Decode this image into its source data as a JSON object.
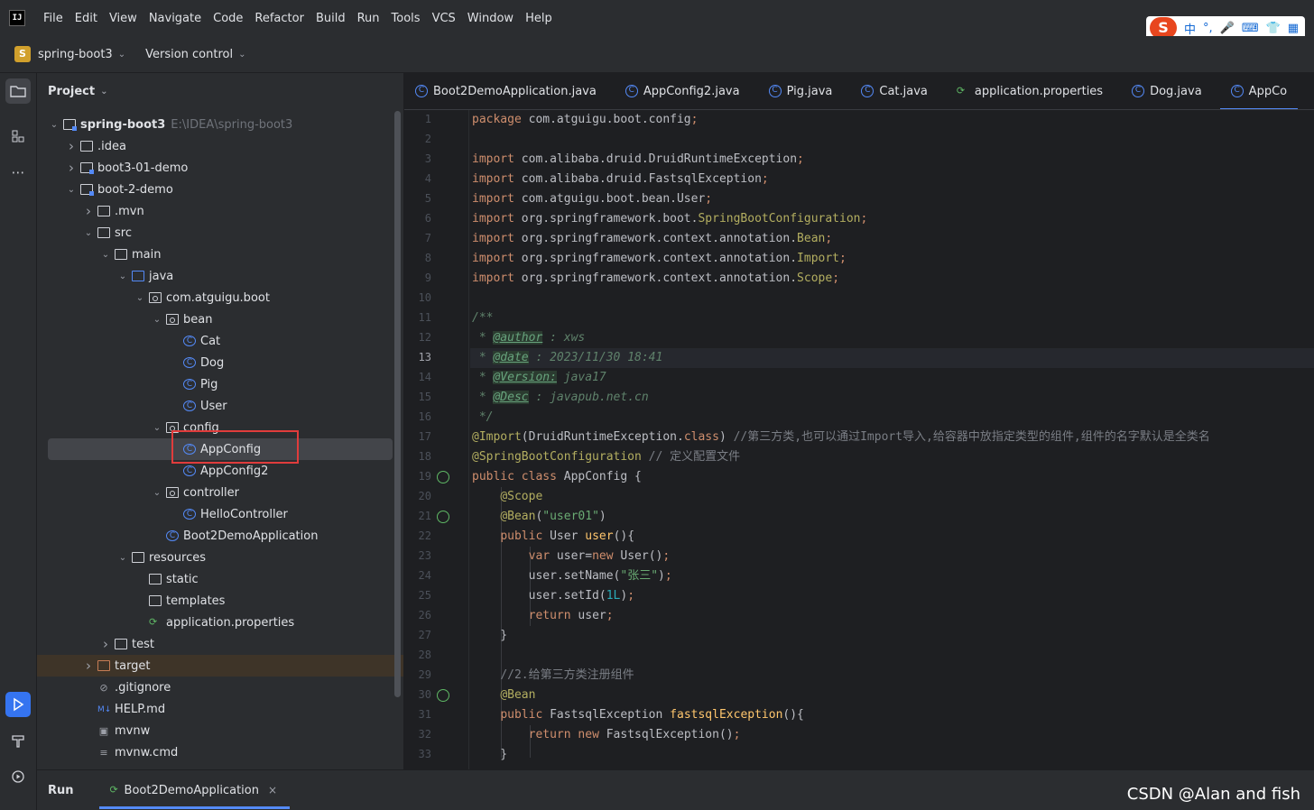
{
  "menubar": {
    "logo": "IJ",
    "items": [
      "File",
      "Edit",
      "View",
      "Navigate",
      "Code",
      "Refactor",
      "Build",
      "Run",
      "Tools",
      "VCS",
      "Window",
      "Help"
    ],
    "ime": [
      "中",
      "°,",
      "🎤",
      "⌨",
      "👕",
      "▦"
    ]
  },
  "toolbar": {
    "project_badge": "S",
    "project_name": "spring-boot3",
    "vcs_label": "Version control"
  },
  "project_panel": {
    "title": "Project",
    "tree": [
      {
        "label": "spring-boot3",
        "extra": "E:\\IDEA\\spring-boot3",
        "depth": 0,
        "arrow": "open",
        "icon": "module",
        "bold": true
      },
      {
        "label": ".idea",
        "depth": 1,
        "arrow": "closed",
        "icon": "folder"
      },
      {
        "label": "boot3-01-demo",
        "depth": 1,
        "arrow": "closed",
        "icon": "module"
      },
      {
        "label": "boot-2-demo",
        "depth": 1,
        "arrow": "open",
        "icon": "module"
      },
      {
        "label": ".mvn",
        "depth": 2,
        "arrow": "closed",
        "icon": "folder"
      },
      {
        "label": "src",
        "depth": 2,
        "arrow": "open",
        "icon": "folder"
      },
      {
        "label": "main",
        "depth": 3,
        "arrow": "open",
        "icon": "folder"
      },
      {
        "label": "java",
        "depth": 4,
        "arrow": "open",
        "icon": "folder-blue"
      },
      {
        "label": "com.atguigu.boot",
        "depth": 5,
        "arrow": "open",
        "icon": "package"
      },
      {
        "label": "bean",
        "depth": 6,
        "arrow": "open",
        "icon": "package"
      },
      {
        "label": "Cat",
        "depth": 7,
        "arrow": "none",
        "icon": "class"
      },
      {
        "label": "Dog",
        "depth": 7,
        "arrow": "none",
        "icon": "class"
      },
      {
        "label": "Pig",
        "depth": 7,
        "arrow": "none",
        "icon": "class"
      },
      {
        "label": "User",
        "depth": 7,
        "arrow": "none",
        "icon": "class"
      },
      {
        "label": "config",
        "depth": 6,
        "arrow": "open",
        "icon": "package"
      },
      {
        "label": "AppConfig",
        "depth": 7,
        "arrow": "none",
        "icon": "class",
        "selected": true
      },
      {
        "label": "AppConfig2",
        "depth": 7,
        "arrow": "none",
        "icon": "class"
      },
      {
        "label": "controller",
        "depth": 6,
        "arrow": "open",
        "icon": "package"
      },
      {
        "label": "HelloController",
        "depth": 7,
        "arrow": "none",
        "icon": "class"
      },
      {
        "label": "Boot2DemoApplication",
        "depth": 6,
        "arrow": "none",
        "icon": "class"
      },
      {
        "label": "resources",
        "depth": 4,
        "arrow": "open",
        "icon": "folder"
      },
      {
        "label": "static",
        "depth": 5,
        "arrow": "none",
        "icon": "folder"
      },
      {
        "label": "templates",
        "depth": 5,
        "arrow": "none",
        "icon": "folder"
      },
      {
        "label": "application.properties",
        "depth": 5,
        "arrow": "none",
        "icon": "props"
      },
      {
        "label": "test",
        "depth": 3,
        "arrow": "closed",
        "icon": "folder"
      },
      {
        "label": "target",
        "depth": 2,
        "arrow": "closed",
        "icon": "folder-orange"
      },
      {
        "label": ".gitignore",
        "depth": 2,
        "arrow": "none",
        "icon": "gitignore"
      },
      {
        "label": "HELP.md",
        "depth": 2,
        "arrow": "none",
        "icon": "md"
      },
      {
        "label": "mvnw",
        "depth": 2,
        "arrow": "none",
        "icon": "shell"
      },
      {
        "label": "mvnw.cmd",
        "depth": 2,
        "arrow": "none",
        "icon": "text"
      }
    ]
  },
  "tabs": [
    {
      "label": "Boot2DemoApplication.java",
      "icon": "class"
    },
    {
      "label": "AppConfig2.java",
      "icon": "class"
    },
    {
      "label": "Pig.java",
      "icon": "class"
    },
    {
      "label": "Cat.java",
      "icon": "class"
    },
    {
      "label": "application.properties",
      "icon": "props"
    },
    {
      "label": "Dog.java",
      "icon": "class"
    },
    {
      "label": "AppCo",
      "icon": "class",
      "active": true
    }
  ],
  "editor": {
    "current_line": 13,
    "line_numbers": [
      "1",
      "2",
      "3",
      "4",
      "5",
      "6",
      "7",
      "8",
      "9",
      "10",
      "11",
      "12",
      "13",
      "14",
      "15",
      "16",
      "17",
      "18",
      "19",
      "20",
      "21",
      "22",
      "23",
      "24",
      "25",
      "26",
      "27",
      "28",
      "29",
      "30",
      "31",
      "32",
      "33"
    ]
  },
  "bottombar": {
    "run_label": "Run",
    "run_tab": "Boot2DemoApplication",
    "close": "×"
  },
  "watermark": "CSDN @Alan and fish"
}
